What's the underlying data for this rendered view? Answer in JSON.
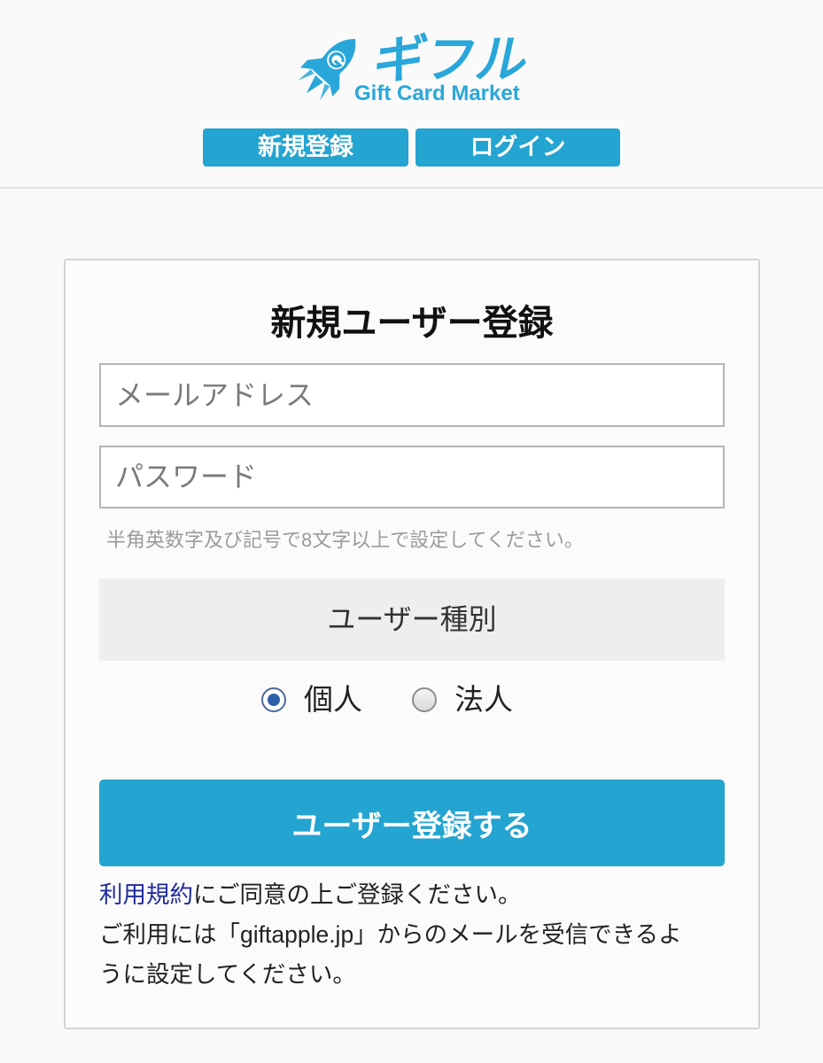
{
  "header": {
    "logo": {
      "name": "ギフル",
      "tagline": "Gift Card Market",
      "icon": "rocket-icon"
    },
    "nav": {
      "register": "新規登録",
      "login": "ログイン"
    }
  },
  "form": {
    "title": "新規ユーザー登録",
    "email_placeholder": "メールアドレス",
    "password_placeholder": "パスワード",
    "password_hint": "半角英数字及び記号で8文字以上で設定してください。",
    "user_type": {
      "heading": "ユーザー種別",
      "options": [
        {
          "label": "個人",
          "selected": true
        },
        {
          "label": "法人",
          "selected": false
        }
      ]
    },
    "submit": "ユーザー登録する",
    "terms": {
      "link": "利用規約",
      "after_link": "にご同意の上ご登録ください。",
      "notice_lines": [
        "ご利用には「giftapple.jp」からのメールを受信できるよ",
        "うに設定してください。"
      ]
    }
  },
  "colors": {
    "accent": "#24a4d0",
    "logo": "#2aa7da",
    "link": "#1f2b9c",
    "radio_selected": "#2d5fa8"
  }
}
